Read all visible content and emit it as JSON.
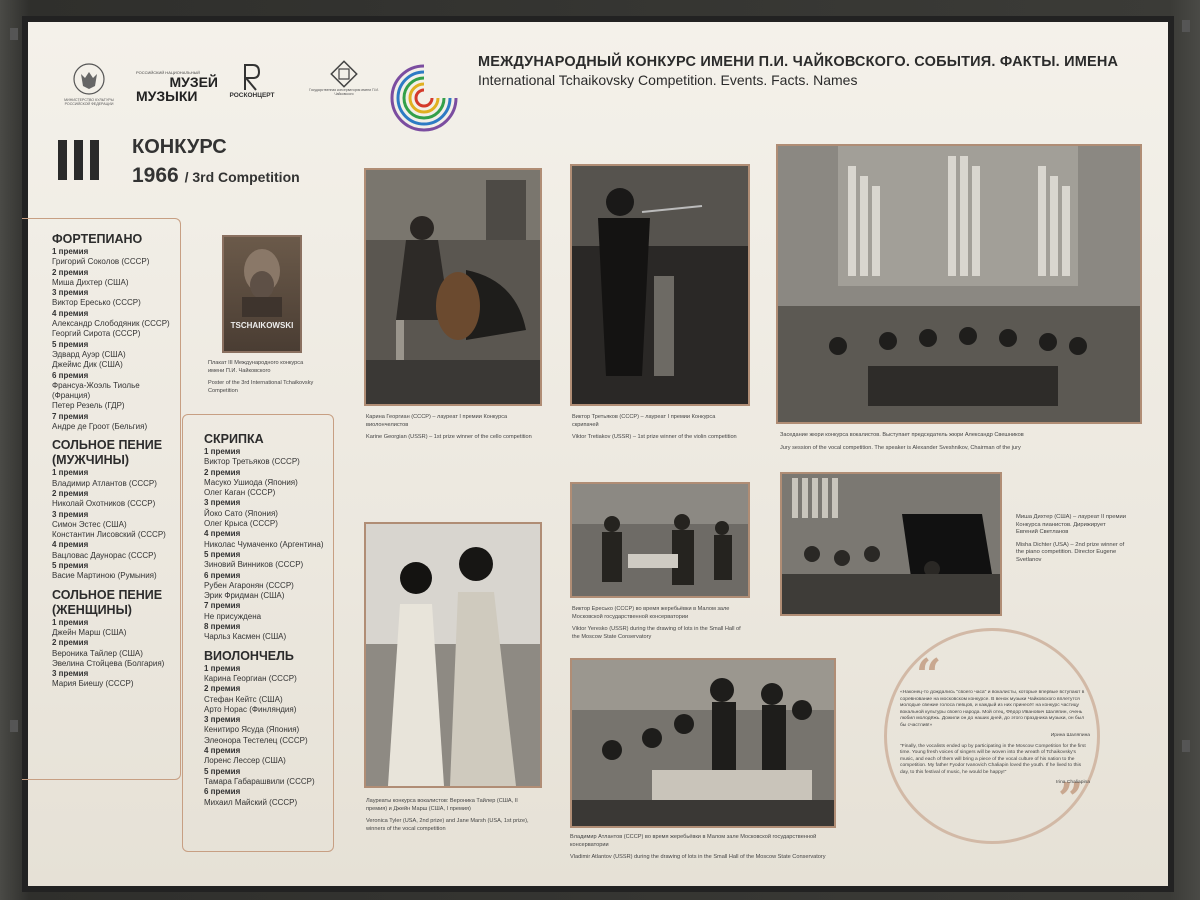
{
  "logos": {
    "ministry": "МИНИСТЕРСТВО КУЛЬТУРЫ РОССИЙСКОЙ ФЕДЕРАЦИИ",
    "museum_top": "РОССИЙСКИЙ НАЦИОНАЛЬНЫЙ",
    "museum_name1": "МУЗЕЙ",
    "museum_name2": "МУЗЫКИ",
    "rosconcert": "РОСКОНЦЕРТ",
    "conservatory": "Государственная консерватория имени П.И. Чайковского"
  },
  "header": {
    "title_ru": "МЕЖДУНАРОДНЫЙ КОНКУРС ИМЕНИ П.И. ЧАЙКОВСКОГО. СОБЫТИЯ. ФАКТЫ. ИМЕНА",
    "title_en": "International Tchaikovsky Competition. Events. Facts. Names"
  },
  "competition": {
    "numeral": "III",
    "label_ru": "КОНКУРС",
    "year": "1966",
    "label_en": "/ 3rd Competition"
  },
  "poster": {
    "text": "TSCHAIKOWSKI",
    "caption_ru": "Плакат III Международного конкурса имени П.И. Чайковского",
    "caption_en": "Poster of the 3rd International Tchaikovsky Competition"
  },
  "winners_left": [
    {
      "category": "ФОРТЕПИАНО",
      "prizes": [
        {
          "prize": "1 премия",
          "names": [
            "Григорий Соколов (СССР)"
          ]
        },
        {
          "prize": "2 премия",
          "names": [
            "Миша Дихтер (США)"
          ]
        },
        {
          "prize": "3 премия",
          "names": [
            "Виктор Ересько (СССР)"
          ]
        },
        {
          "prize": "4 премия",
          "names": [
            "Александр Слободяник (СССР)",
            "Георгий Сирота (СССР)"
          ]
        },
        {
          "prize": "5 премия",
          "names": [
            "Эдвард Ауэр (США)",
            "Джеймс Дик (США)"
          ]
        },
        {
          "prize": "6 премия",
          "names": [
            "Франсуа-Жоэль Тиолье (Франция)",
            "Петер Резель (ГДР)"
          ]
        },
        {
          "prize": "7 премия",
          "names": [
            "Андре де Гроот (Бельгия)"
          ]
        }
      ]
    },
    {
      "category": "СОЛЬНОЕ ПЕНИЕ (МУЖЧИНЫ)",
      "prizes": [
        {
          "prize": "1 премия",
          "names": [
            "Владимир Атлантов (СССР)"
          ]
        },
        {
          "prize": "2 премия",
          "names": [
            "Николай Охотников (СССР)"
          ]
        },
        {
          "prize": "3 премия",
          "names": [
            "Симон Эстес (США)",
            "Константин Лисовский (СССР)"
          ]
        },
        {
          "prize": "4 премия",
          "names": [
            "Вацловас Даунорас (СССР)"
          ]
        },
        {
          "prize": "5 премия",
          "names": [
            "Васие Мартиною (Румыния)"
          ]
        }
      ]
    },
    {
      "category": "СОЛЬНОЕ ПЕНИЕ (ЖЕНЩИНЫ)",
      "prizes": [
        {
          "prize": "1 премия",
          "names": [
            "Джейн Марш (США)"
          ]
        },
        {
          "prize": "2 премия",
          "names": [
            "Вероника Тайлер (США)",
            "Эвелина Стойцева (Болгария)"
          ]
        },
        {
          "prize": "3 премия",
          "names": [
            "Мария Биешу (СССР)"
          ]
        }
      ]
    }
  ],
  "winners_right": [
    {
      "category": "СКРИПКА",
      "prizes": [
        {
          "prize": "1 премия",
          "names": [
            "Виктор Третьяков (СССР)"
          ]
        },
        {
          "prize": "2 премия",
          "names": [
            "Масуко Ушиода (Япония)",
            "Олег Каган (СССР)"
          ]
        },
        {
          "prize": "3 премия",
          "names": [
            "Йоко Сато (Япония)",
            "Олег Крыса (СССР)"
          ]
        },
        {
          "prize": "4 премия",
          "names": [
            "Николас Чумаченко (Аргентина)"
          ]
        },
        {
          "prize": "5 премия",
          "names": [
            "Зиновий Винников (СССР)"
          ]
        },
        {
          "prize": "6 премия",
          "names": [
            "Рубен Агаронян (СССР)",
            "Эрик Фридман (США)"
          ]
        },
        {
          "prize": "7 премия",
          "names": [
            "Не присуждена"
          ]
        },
        {
          "prize": "8 премия",
          "names": [
            "Чарльз Касмен (США)"
          ]
        }
      ]
    },
    {
      "category": "ВИОЛОНЧЕЛЬ",
      "prizes": [
        {
          "prize": "1 премия",
          "names": [
            "Карина Георгиан (СССР)"
          ]
        },
        {
          "prize": "2 премия",
          "names": [
            "Стефан Кейтс (США)",
            "Арто Норас (Финляндия)"
          ]
        },
        {
          "prize": "3 премия",
          "names": [
            "Кенитиро Ясуда (Япония)",
            "Элеонора Тестелец (СССР)"
          ]
        },
        {
          "prize": "4 премия",
          "names": [
            "Лоренс Лессер (США)"
          ]
        },
        {
          "prize": "5 премия",
          "names": [
            "Тамара Габарашвили (СССР)"
          ]
        },
        {
          "prize": "6 премия",
          "names": [
            "Михаил Майский (СССР)"
          ]
        }
      ]
    }
  ],
  "captions": {
    "cello": {
      "ru": "Карина Георгиан (СССР) – лауреат I премии Конкурса виолончелистов",
      "en": "Karine Georgian (USSR) – 1st prize winner of the cello competition"
    },
    "violin": {
      "ru": "Виктор Третьяков (СССР) – лауреат I премии Конкурса скрипачей",
      "en": "Viktor Tretiakov (USSR) – 1st prize winner of the violin competition"
    },
    "jury": {
      "ru": "Заседание жюри конкурса вокалистов. Выступает председатель жюри Александр Свешников",
      "en": "Jury session of the vocal competition. The speaker is Alexander Sveshnikov, Chairman of the jury"
    },
    "dichter": {
      "ru": "Миша Дихтер (США) – лауреат II премии Конкурса пианистов. Дирижирует Евгений Светланов",
      "en": "Misha Dichter (USA) – 2nd prize winner of the piano competition. Director Eugene Svetlanov"
    },
    "yeresko": {
      "ru": "Виктор Ересько (СССР) во время жеребьёвки в Малом зале Московской государственной консерватории",
      "en": "Viktor Yeresko (USSR) during the drawing of lots in the Small Hall of the Moscow State Conservatory"
    },
    "singers": {
      "ru": "Лауреаты конкурса вокалистов: Вероника Тайлер (США, II премия) и Джейн Марш (США, I премия)",
      "en": "Veronica Tyler (USA, 2nd prize) and Jane Marsh (USA, 1st prize), winners of the vocal competition"
    },
    "atlantov": {
      "ru": "Владимир Атлантов (СССР) во время жеребьёвки в Малом зале Московской государственной консерватории",
      "en": "Vladimir Atlantov (USSR) during the drawing of lots in the Small Hall of the Moscow State Conservatory"
    }
  },
  "quote": {
    "ru": "«Наконец-то дождались \"своего часа\" и вокалисты, которые впервые вступают в соревнование на московском конкурсе. В венок музыки Чайковского вплетутся молодые свежие голоса певцов, и каждый из них принесёт на конкурс частицу вокальной культуры своего народа. Мой отец, Фёдор Иванович Шаляпин, очень любил молодёжь. Дожили он до наших дней, до этого праздника музыки, он был бы счастлив!»",
    "ru_author": "Ирина Шаляпина",
    "en": "\"Finally, the vocalists ended up by participating in the Moscow Competition for the first time. Young fresh voices of singers will be woven into the wreath of Tchaikovsky's music, and each of them will bring a piece of the vocal culture of his nation to the competition. My father Fyodor Ivanovich Chaliapin loved the youth. If he lived to this day, to this festival of music, he would be happy!\"",
    "en_author": "Irina Chaliapina"
  }
}
